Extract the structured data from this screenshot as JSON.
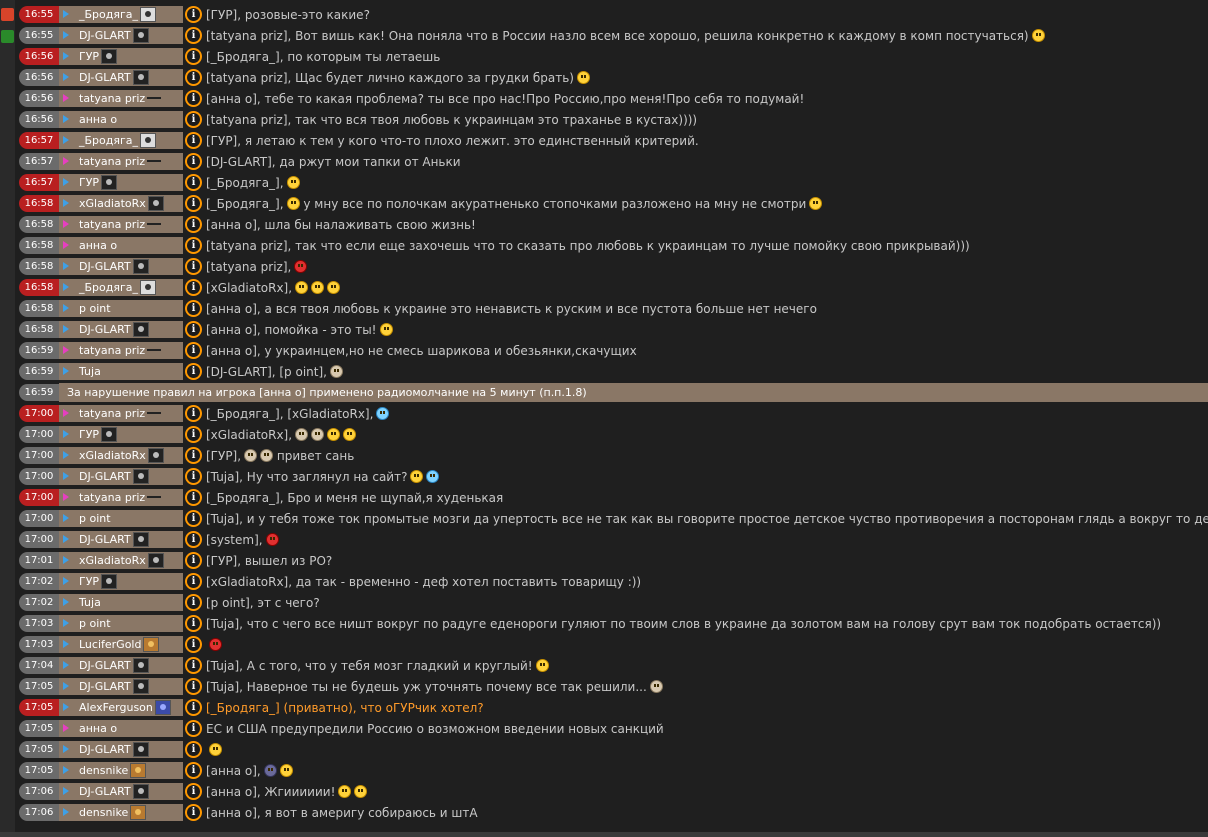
{
  "left_strip": {
    "chips": [
      {
        "color": "#d8442a"
      },
      {
        "color": "#2a8a2a"
      }
    ]
  },
  "rows": [
    {
      "time": "16:55",
      "red": true,
      "nick": "_Бродяга_",
      "av": "light",
      "female": false,
      "text": "[ГУР], розовые-это какие?",
      "emoji": []
    },
    {
      "time": "16:55",
      "red": false,
      "nick": "DJ-GLART",
      "av": "dark",
      "female": false,
      "text": "[tatyana priz], Вот вишь как! Она поняла что в России назло всем все хорошо, решила конкретно к каждому в комп постучаться)",
      "emoji": [
        "yellow"
      ]
    },
    {
      "time": "16:56",
      "red": true,
      "nick": "ГУР",
      "av": "dark",
      "female": false,
      "text": "[_Бродяга_], по которым ты летаешь",
      "emoji": []
    },
    {
      "time": "16:56",
      "red": false,
      "nick": "DJ-GLART",
      "av": "dark",
      "female": false,
      "text": "[tatyana priz], Щас будет лично каждого за грудки брать)",
      "emoji": [
        "yellow"
      ]
    },
    {
      "time": "16:56",
      "red": false,
      "nick": "tatyana priz",
      "av": "pic",
      "female": true,
      "text": "[анна о], тебе то какая проблема? ты все про нас!Про Россию,про меня!Про себя то подумай!",
      "emoji": []
    },
    {
      "time": "16:56",
      "red": false,
      "nick": "анна о",
      "av": "none",
      "female": false,
      "text": "[tatyana priz], так что вся твоя любовь к украинцам это траханье в кустах))))",
      "emoji": []
    },
    {
      "time": "16:57",
      "red": true,
      "nick": "_Бродяга_",
      "av": "light",
      "female": false,
      "text": "[ГУР], я летаю к тем у кого что-то плохо лежит. это единственный критерий.",
      "emoji": []
    },
    {
      "time": "16:57",
      "red": false,
      "nick": "tatyana priz",
      "av": "pic",
      "female": true,
      "text": "[DJ-GLART], да ржут мои тапки от Аньки",
      "emoji": []
    },
    {
      "time": "16:57",
      "red": true,
      "nick": "ГУР",
      "av": "dark",
      "female": false,
      "text": "[_Бродяга_],",
      "emoji": [
        "yellow"
      ]
    },
    {
      "time": "16:58",
      "red": true,
      "nick": "xGladiatoRx",
      "av": "dark",
      "female": false,
      "text": "[_Бродяга_],",
      "emoji": [
        "yellow"
      ],
      "text2": "у мну все по полочкам акуратненько стопочками разложено на мну не смотри",
      "emoji2": [
        "yellow"
      ]
    },
    {
      "time": "16:58",
      "red": false,
      "nick": "tatyana priz",
      "av": "pic",
      "female": true,
      "text": "[анна о], шла бы налаживать свою жизнь!",
      "emoji": []
    },
    {
      "time": "16:58",
      "red": false,
      "nick": "анна о",
      "av": "none",
      "female": true,
      "text": "[tatyana priz], так что если еще захочешь что то сказать про любовь к украинцам то лучше помойку свою прикрывай)))",
      "emoji": []
    },
    {
      "time": "16:58",
      "red": false,
      "nick": "DJ-GLART",
      "av": "dark",
      "female": false,
      "text": "[tatyana priz],",
      "emoji": [
        "red"
      ]
    },
    {
      "time": "16:58",
      "red": true,
      "nick": "_Бродяга_",
      "av": "light",
      "female": false,
      "text": "[xGladiatoRx],",
      "emoji": [
        "yellow",
        "yellow",
        "yellow"
      ]
    },
    {
      "time": "16:58",
      "red": false,
      "nick": "p oint",
      "av": "none",
      "female": false,
      "text": "[анна о], а вся твоя любовь к украине это ненависть к руским и все пустота больше нет нечего",
      "emoji": []
    },
    {
      "time": "16:58",
      "red": false,
      "nick": "DJ-GLART",
      "av": "dark",
      "female": false,
      "text": "[анна о], помойка - это ты!",
      "emoji": [
        "yellow"
      ]
    },
    {
      "time": "16:59",
      "red": false,
      "nick": "tatyana priz",
      "av": "pic",
      "female": true,
      "text": "[анна о], у украинцем,но не смесь шарикова и обезьянки,скачущих",
      "emoji": []
    },
    {
      "time": "16:59",
      "red": false,
      "nick": "Tuja",
      "av": "none",
      "female": false,
      "text": "[DJ-GLART], [p oint],",
      "emoji": [
        "grey"
      ]
    },
    {
      "time": "16:59",
      "system": true,
      "text": "За нарушение правил на игрока [анна о] применено радиомолчание на 5 минут (п.п.1.8)"
    },
    {
      "time": "17:00",
      "red": true,
      "nick": "tatyana priz",
      "av": "pic",
      "female": true,
      "text": "[_Бродяга_], [xGladiatoRx],",
      "emoji": [
        "blue"
      ]
    },
    {
      "time": "17:00",
      "red": false,
      "nick": "ГУР",
      "av": "dark",
      "female": false,
      "text": "[xGladiatoRx],",
      "emoji": [
        "grey",
        "grey",
        "yellow",
        "yellow"
      ]
    },
    {
      "time": "17:00",
      "red": false,
      "nick": "xGladiatoRx",
      "av": "dark",
      "female": false,
      "text": "[ГУР],",
      "emoji": [
        "grey",
        "grey"
      ],
      "text2": "привет сань",
      "emoji2": []
    },
    {
      "time": "17:00",
      "red": false,
      "nick": "DJ-GLART",
      "av": "dark",
      "female": false,
      "text": "[Tuja], Ну что заглянул на сайт?",
      "emoji": [
        "yellow",
        "blue"
      ]
    },
    {
      "time": "17:00",
      "red": true,
      "nick": "tatyana priz",
      "av": "pic",
      "female": true,
      "text": "[_Бродяга_], Бро и меня не щупай,я худенькая",
      "emoji": []
    },
    {
      "time": "17:00",
      "red": false,
      "nick": "p oint",
      "av": "none",
      "female": false,
      "text": "[Tuja], и у тебя тоже ток промытые мозги да упертость все не так как вы говорите простое детское чуство противоречия а посторонам глядь а вокруг то дерьмецо",
      "emoji": []
    },
    {
      "time": "17:00",
      "red": false,
      "nick": "DJ-GLART",
      "av": "dark",
      "female": false,
      "text": "[system],",
      "emoji": [
        "red"
      ]
    },
    {
      "time": "17:01",
      "red": false,
      "nick": "xGladiatoRx",
      "av": "dark",
      "female": false,
      "text": "[ГУР], вышел из РО?",
      "emoji": []
    },
    {
      "time": "17:02",
      "red": false,
      "nick": "ГУР",
      "av": "dark",
      "female": false,
      "text": "[xGladiatoRx], да так - временно - деф хотел поставить товарищу :))",
      "emoji": []
    },
    {
      "time": "17:02",
      "red": false,
      "nick": "Tuja",
      "av": "none",
      "female": false,
      "text": "[p oint], эт с чего?",
      "emoji": []
    },
    {
      "time": "17:03",
      "red": false,
      "nick": "p oint",
      "av": "none",
      "female": false,
      "text": "[Tuja], что с чего все ништ вокруг по радуге еденороги гуляют по твоим слов в украине да золотом вам на голову срут вам ток подобрать остается))",
      "emoji": []
    },
    {
      "time": "17:03",
      "red": false,
      "nick": "LuciferGold",
      "av": "gold",
      "female": false,
      "text": "",
      "emoji": [
        "red"
      ]
    },
    {
      "time": "17:04",
      "red": false,
      "nick": "DJ-GLART",
      "av": "dark",
      "female": false,
      "text": "[Tuja], А с того, что у тебя мозг гладкий и круглый!",
      "emoji": [
        "yellow"
      ]
    },
    {
      "time": "17:05",
      "red": false,
      "nick": "DJ-GLART",
      "av": "dark",
      "female": false,
      "text": "[Tuja], Наверное ты не будешь уж уточнять почему все так решили...",
      "emoji": [
        "grey"
      ]
    },
    {
      "time": "17:05",
      "red": true,
      "nick": "AlexFerguson",
      "av": "blue",
      "female": false,
      "text": "[_Бродяга_] (приватно), что оГУРчик хотел?",
      "emoji": [],
      "orange": true
    },
    {
      "time": "17:05",
      "red": false,
      "nick": "анна о",
      "av": "none",
      "female": true,
      "text": "ЕС и США предупредили Россию о возможном введении новых санкций",
      "emoji": []
    },
    {
      "time": "17:05",
      "red": false,
      "nick": "DJ-GLART",
      "av": "dark",
      "female": false,
      "text": "",
      "emoji": [
        "yellow"
      ]
    },
    {
      "time": "17:05",
      "red": false,
      "nick": "densnike",
      "av": "gold",
      "female": false,
      "text": "[анна о],",
      "emoji": [
        "dark",
        "yellow"
      ]
    },
    {
      "time": "17:06",
      "red": false,
      "nick": "DJ-GLART",
      "av": "dark",
      "female": false,
      "text": "[анна о], Жгииииии!",
      "emoji": [
        "yellow",
        "yellow"
      ]
    },
    {
      "time": "17:06",
      "red": false,
      "nick": "densnike",
      "av": "gold",
      "female": false,
      "text": "[анна о], я вот в америгу собираюсь и штА",
      "emoji": []
    }
  ],
  "icons": {
    "info": "i"
  }
}
